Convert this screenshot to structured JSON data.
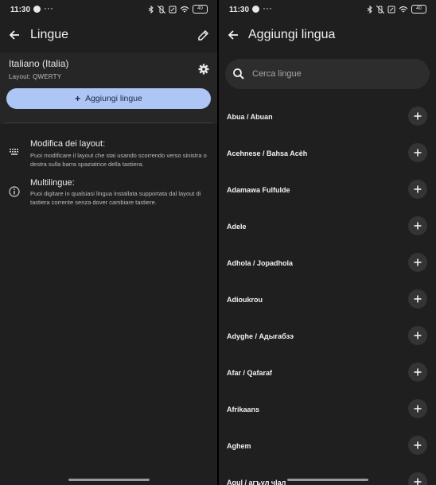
{
  "status_bar": {
    "time": "11:30",
    "dots": "···",
    "battery": "40"
  },
  "left": {
    "title": "Lingue",
    "language_name": "Italiano (Italia)",
    "layout_label": "Layout: QWERTY",
    "add_button_label": "Aggiungi lingue",
    "info": [
      {
        "title": "Modifica dei layout:",
        "desc": "Puoi modificare il layout che stai usando scorrendo verso sinistra o destra sulla barra spaziatrice della tastiera.",
        "icon": "keyboard-icon"
      },
      {
        "title": "Multilingue:",
        "desc": "Puoi digitare in qualsiasi lingua installata supportata dal layout di tastiera corrente senza dover cambiare tastiere.",
        "icon": "info-icon"
      }
    ]
  },
  "right": {
    "title": "Aggiungi lingua",
    "search_placeholder": "Cerca lingue",
    "languages": [
      "Abua / Abuan",
      "Acehnese / Bahsa Acèh",
      "Adamawa Fulfulde",
      "Adele",
      "Adhola / Jopadhola",
      "Adioukrou",
      "Adyghe / Адыгабзэ",
      "Afar / Qafaraf",
      "Afrikaans",
      "Aghem",
      "Agul / агъул чIал"
    ]
  },
  "colors": {
    "accent_button": "#aec6f6",
    "background": "#1f1f1f"
  }
}
